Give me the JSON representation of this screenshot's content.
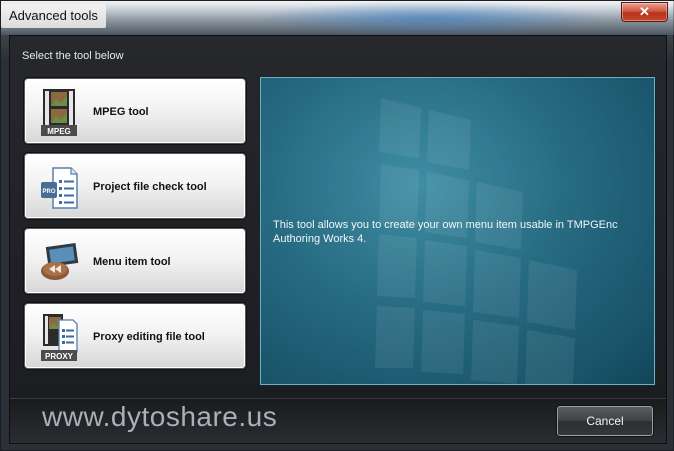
{
  "window": {
    "title": "Advanced tools",
    "close_glyph": "✕"
  },
  "prompt": "Select the tool below",
  "tools": [
    {
      "label": "MPEG tool",
      "icon": "mpeg-film-icon",
      "badge": "MPEG"
    },
    {
      "label": "Project file check tool",
      "icon": "project-file-check-icon",
      "badge": "PRO"
    },
    {
      "label": "Menu item tool",
      "icon": "menu-item-icon",
      "badge": ""
    },
    {
      "label": "Proxy editing file tool",
      "icon": "proxy-file-icon",
      "badge": "PROXY"
    }
  ],
  "description": "This tool allows you to create your own menu item usable in TMPGEnc Authoring Works 4.",
  "footer": {
    "watermark": "www.dytoshare.us",
    "cancel_label": "Cancel"
  },
  "colors": {
    "panel_accent": "#276b82",
    "close_red": "#c44a31"
  }
}
